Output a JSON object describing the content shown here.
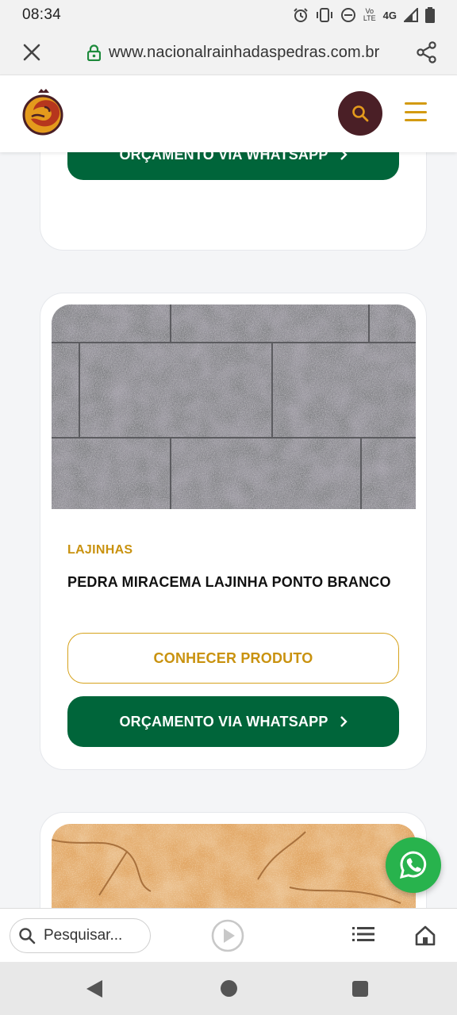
{
  "status_bar": {
    "time": "08:34",
    "volte_top": "Vo",
    "volte_bottom": "LTE",
    "network": "4G",
    "icons": [
      "alarm-icon",
      "vibrate-icon",
      "dnd-icon",
      "signal-icon",
      "battery-icon"
    ]
  },
  "browser": {
    "url": "www.nacionalrainhadaspedras.com.br",
    "icons": [
      "close-icon",
      "lock-icon",
      "share-icon"
    ]
  },
  "header": {
    "icons": [
      "logo",
      "search-icon",
      "menu-icon"
    ]
  },
  "cards": [
    {
      "whatsapp_label": "ORÇAMENTO VIA WHATSAPP"
    },
    {
      "category": "LAJINHAS",
      "title": "PEDRA MIRACEMA LAJINHA PONTO BRANCO",
      "know_label": "CONHECER PRODUTO",
      "whatsapp_label": "ORÇAMENTO VIA WHATSAPP"
    }
  ],
  "bottom_bar": {
    "search_placeholder": "Pesquisar..."
  },
  "colors": {
    "gold": "#c9920f",
    "green": "#00653a",
    "whatsapp": "#28b34d",
    "brand_dark": "#4a1f26"
  }
}
